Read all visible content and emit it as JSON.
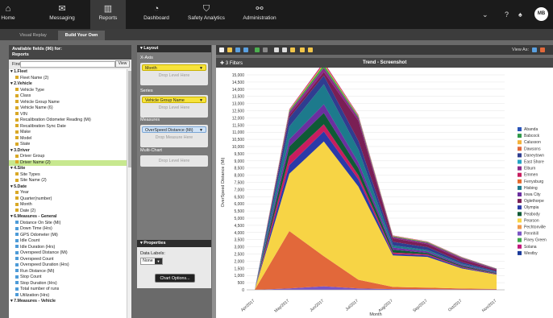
{
  "nav": {
    "items": [
      {
        "label": "Home",
        "icon": "home-icon",
        "glyph": "⌂"
      },
      {
        "label": "Messaging",
        "icon": "envelope-icon",
        "glyph": "✉"
      },
      {
        "label": "Reports",
        "icon": "reports-icon",
        "glyph": "▥"
      },
      {
        "label": "Dashboard",
        "icon": "dashboard-icon",
        "glyph": "◔"
      },
      {
        "label": "Safety Analytics",
        "icon": "shield-icon",
        "glyph": "⛉"
      },
      {
        "label": "Administration",
        "icon": "link-icon",
        "glyph": "⚯"
      }
    ],
    "active": "Reports",
    "avatar": "MB"
  },
  "subnav": {
    "tabs": [
      "Visual Replay",
      "Build Your Own"
    ],
    "active": "Build Your Own"
  },
  "fields_panel": {
    "header_line1": "Available fields (96) for:",
    "header_line2": "Reports",
    "find_label": "Find:",
    "view_label": "View",
    "items": [
      {
        "t": "cat",
        "label": "1.Fleet"
      },
      {
        "t": "dim",
        "label": "Fleet Name (2)"
      },
      {
        "t": "cat",
        "label": "2.Vehicle"
      },
      {
        "t": "dim",
        "label": "Vehicle Type"
      },
      {
        "t": "dim",
        "label": "Class"
      },
      {
        "t": "dim",
        "label": "Vehicle Group Name"
      },
      {
        "t": "dim",
        "label": "Vehicle Name (6)"
      },
      {
        "t": "dim",
        "label": "VIN"
      },
      {
        "t": "dim",
        "label": "Recalibration Odometer Reading (Mi)"
      },
      {
        "t": "dim",
        "label": "Recalibration Sync Date"
      },
      {
        "t": "dim",
        "label": "Make"
      },
      {
        "t": "dim",
        "label": "Model"
      },
      {
        "t": "dim",
        "label": "State"
      },
      {
        "t": "cat",
        "label": "3.Driver"
      },
      {
        "t": "dim",
        "label": "Driver Group"
      },
      {
        "t": "dim",
        "label": "Driver Name (2)",
        "selected": true
      },
      {
        "t": "cat",
        "label": "4.Site"
      },
      {
        "t": "dim",
        "label": "Site Types"
      },
      {
        "t": "dim",
        "label": "Site Name (2)"
      },
      {
        "t": "cat",
        "label": "5.Date"
      },
      {
        "t": "dim",
        "label": "Year"
      },
      {
        "t": "dim",
        "label": "Quarter(number)"
      },
      {
        "t": "dim",
        "label": "Month"
      },
      {
        "t": "dim",
        "label": "Date (2)"
      },
      {
        "t": "cat",
        "label": "6.Measures - General"
      },
      {
        "t": "meas",
        "label": "Distance On Site (Mi)"
      },
      {
        "t": "meas",
        "label": "Down Time (Hrs)"
      },
      {
        "t": "meas",
        "label": "GPS Odometer (Mi)"
      },
      {
        "t": "meas",
        "label": "Idle Count"
      },
      {
        "t": "meas",
        "label": "Idle Duration (Hrs)"
      },
      {
        "t": "meas",
        "label": "Overspeed Distance (Mi)"
      },
      {
        "t": "meas",
        "label": "Overspeed Count"
      },
      {
        "t": "meas",
        "label": "Overspeed Duration (Hrs)"
      },
      {
        "t": "meas",
        "label": "Run Distance (Mi)"
      },
      {
        "t": "meas",
        "label": "Stop Count"
      },
      {
        "t": "meas",
        "label": "Stop Duration (Hrs)"
      },
      {
        "t": "meas",
        "label": "Total number of runs"
      },
      {
        "t": "meas",
        "label": "Utilization (Hrs)"
      },
      {
        "t": "cat",
        "label": "7.Measures - Vehicle"
      }
    ]
  },
  "layout_panel": {
    "title": "Layout",
    "xaxis_label": "X-Axis",
    "xaxis_value": "Month",
    "series_label": "Series",
    "series_value": "Vehicle Group Name",
    "measures_label": "Measures",
    "measures_value": "OverSpeed Distance (Mi)",
    "multichart_label": "Multi-Chart",
    "drop_level": "Drop Level Here",
    "drop_measure": "Drop Measure Here"
  },
  "properties_panel": {
    "title": "Properties",
    "data_labels_label": "Data Labels:",
    "data_labels_value": "None",
    "chart_options": "Chart Options..."
  },
  "chart_header": {
    "filters": "3 Filters",
    "title": "Trend - Screenshot",
    "view_as": "View As:"
  },
  "colors": {
    "Abanda": "#2a54b8",
    "Babcock": "#2f9a4a",
    "Calusson": "#f4b23a",
    "Dawsons": "#e2683a",
    "Daneytown": "#2f3d90",
    "East Shore": "#23a3c4",
    "Elburn": "#8a2b8a",
    "Emmen": "#c81d5f",
    "Ferrysburg": "#e46a2e",
    "Hisbing": "#1d7a8c",
    "Iowa City": "#6b2fa0",
    "Oglethorpe": "#7a1f55",
    "Olympia": "#2a3aa8",
    "Peabody": "#0f5a36",
    "Pearson": "#f7d445",
    "Pechtonville": "#f19a4a",
    "Pennhill": "#7a55c4",
    "Piney Green": "#3fa84a",
    "Solana": "#c2187c",
    "Westby": "#1a3a9a"
  },
  "chart_data": {
    "type": "area",
    "stacked": true,
    "xlabel": "Month",
    "ylabel": "OverSpeed Distance (Mi)",
    "ylim": [
      0,
      15000
    ],
    "yticks": [
      0,
      500,
      1000,
      1500,
      2000,
      2500,
      3000,
      3500,
      4000,
      4500,
      5000,
      5500,
      6000,
      6500,
      7000,
      7500,
      8000,
      8500,
      9000,
      9500,
      10000,
      10500,
      11000,
      11500,
      12000,
      12500,
      13000,
      13500,
      14000,
      14500,
      15000
    ],
    "ytick_labels": [
      "0",
      "500",
      "1,000",
      "1,500",
      "2,000",
      "2,500",
      "3,000",
      "3,500",
      "4,000",
      "4,500",
      "5,000",
      "5,500",
      "6,000",
      "6,500",
      "7,000",
      "7,500",
      "8,000",
      "8,500",
      "9,000",
      "9,500",
      "10,000",
      "10,500",
      "11,000",
      "11,500",
      "12,000",
      "12,500",
      "13,000",
      "13,500",
      "14,000",
      "14,500",
      "15,000"
    ],
    "categories": [
      "Apr/2017",
      "May/2017",
      "Jun/2017",
      "Jul/2017",
      "Aug/2017",
      "Sep/2017",
      "Oct/2017",
      "Nov/2017"
    ],
    "legend": [
      "Abanda",
      "Babcock",
      "Calusson",
      "Dawsons",
      "Daneytown",
      "East Shore",
      "Elburn",
      "Emmen",
      "Ferrysburg",
      "Hisbing",
      "Iowa City",
      "Oglethorpe",
      "Olympia",
      "Peabody",
      "Pearson",
      "Pechtonville",
      "Pennhill",
      "Piney Green",
      "Solana",
      "Westby"
    ],
    "legend_position": "right",
    "series": [
      {
        "name": "Pennhill",
        "values": [
          0,
          100,
          250,
          100,
          50,
          50,
          30,
          20
        ]
      },
      {
        "name": "Dawsons",
        "values": [
          0,
          4000,
          2100,
          600,
          150,
          100,
          60,
          40
        ]
      },
      {
        "name": "Pearson",
        "values": [
          0,
          4000,
          8000,
          6500,
          2200,
          2150,
          1400,
          1000
        ]
      },
      {
        "name": "Olympia",
        "values": [
          0,
          600,
          700,
          500,
          100,
          100,
          60,
          30
        ]
      },
      {
        "name": "Emmen",
        "values": [
          0,
          600,
          500,
          300,
          100,
          80,
          50,
          30
        ]
      },
      {
        "name": "Peabody",
        "values": [
          0,
          700,
          800,
          500,
          200,
          100,
          80,
          40
        ]
      },
      {
        "name": "Iowa City",
        "values": [
          0,
          500,
          600,
          400,
          150,
          100,
          80,
          50
        ]
      },
      {
        "name": "Hisbing",
        "values": [
          0,
          900,
          1400,
          900,
          150,
          100,
          60,
          40
        ]
      },
      {
        "name": "Daneytown",
        "values": [
          0,
          600,
          600,
          600,
          250,
          200,
          100,
          50
        ]
      },
      {
        "name": "Oglethorpe",
        "values": [
          0,
          200,
          250,
          1400,
          250,
          200,
          200,
          100
        ]
      },
      {
        "name": "Elburn",
        "values": [
          0,
          200,
          300,
          200,
          100,
          100,
          100,
          50
        ]
      },
      {
        "name": "Piney Green",
        "values": [
          0,
          100,
          200,
          100,
          50,
          50,
          30,
          20
        ]
      },
      {
        "name": "Calusson",
        "values": [
          0,
          50,
          100,
          50,
          30,
          20,
          20,
          10
        ]
      },
      {
        "name": "Solana",
        "values": [
          0,
          50,
          100,
          50,
          20,
          20,
          20,
          10
        ]
      }
    ]
  }
}
